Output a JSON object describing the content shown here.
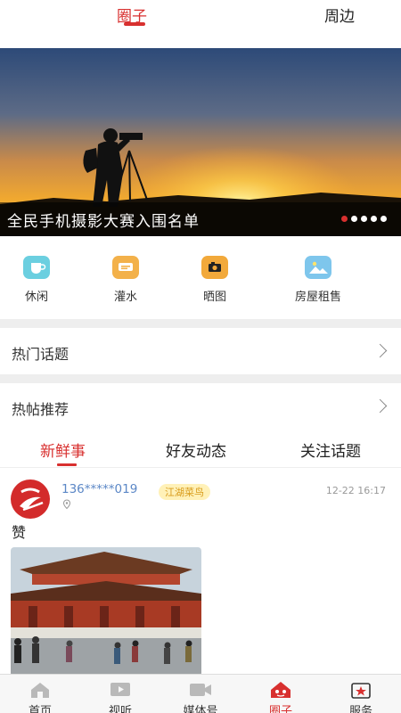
{
  "top_tabs": [
    {
      "label": "圈子",
      "active": true
    },
    {
      "label": "周边",
      "active": false
    }
  ],
  "banner": {
    "title": "全民手机摄影大赛入围名单",
    "slide_count": 5,
    "active_slide": 1
  },
  "categories": [
    {
      "label": "休闲",
      "icon": "cup-icon",
      "color": "#6bcfe0"
    },
    {
      "label": "灌水",
      "icon": "chat-bubble-icon",
      "color": "#f3b14a"
    },
    {
      "label": "晒图",
      "icon": "camera-icon",
      "color": "#f2a93b"
    },
    {
      "label": "房屋租售",
      "icon": "landscape-icon",
      "color": "#7ec6ec"
    }
  ],
  "sections": {
    "hot_topics": "热门话题",
    "hot_posts": "热帖推荐"
  },
  "sub_tabs": [
    {
      "label": "新鲜事",
      "active": true
    },
    {
      "label": "好友动态",
      "active": false
    },
    {
      "label": "关注话题",
      "active": false
    }
  ],
  "post": {
    "user": "136*****019",
    "badge": "江湖菜鸟",
    "time": "12-22 16:17",
    "text": "赞"
  },
  "bottom_nav": [
    {
      "label": "首页",
      "icon": "home-icon",
      "active": false
    },
    {
      "label": "视听",
      "icon": "video-play-icon",
      "active": false
    },
    {
      "label": "媒体号",
      "icon": "camera-video-icon",
      "active": false
    },
    {
      "label": "圈子",
      "icon": "circle-house-icon",
      "active": true
    },
    {
      "label": "服务",
      "icon": "service-icon",
      "active": false
    }
  ],
  "colors": {
    "accent": "#d8302f",
    "link": "#5b87c6",
    "badge_bg": "#fff1b8",
    "badge_text": "#d89b1a"
  }
}
